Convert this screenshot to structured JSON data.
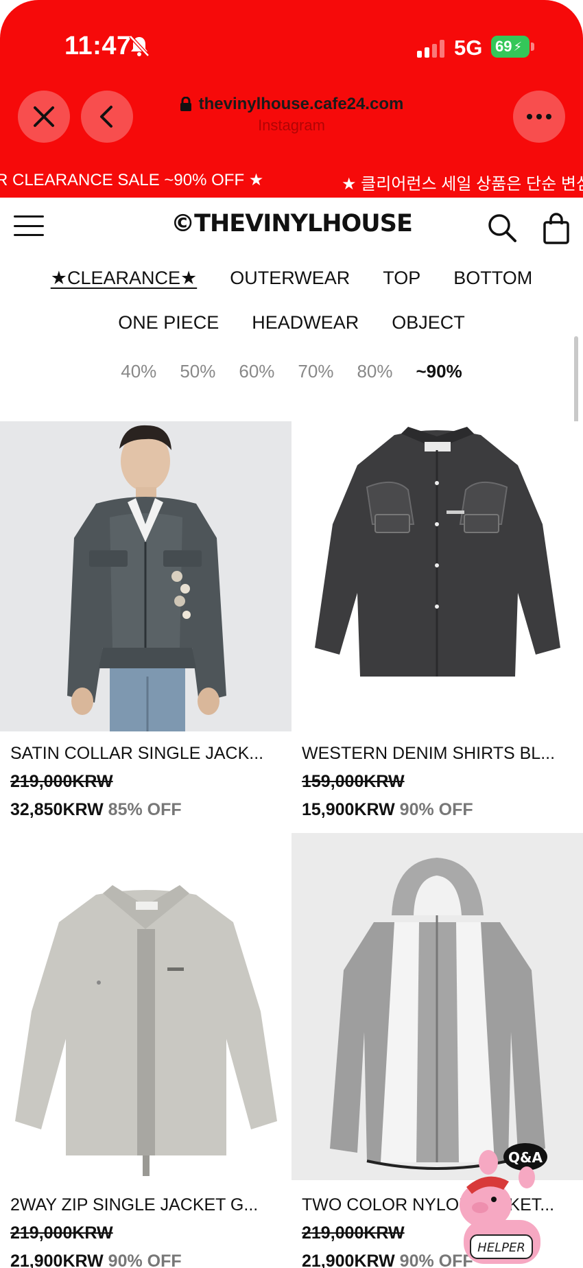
{
  "status_bar": {
    "time": "11:47",
    "network": "5G",
    "battery": "69"
  },
  "browser": {
    "url": "thevinylhouse.cafe24.com",
    "source": "Instagram"
  },
  "marquee": {
    "text_left": "R CLEARANCE SALE ~90% OFF ★",
    "text_right": "★ 클리어런스 세일 상품은 단순 변심"
  },
  "header": {
    "logo": "©THEVINYLHOUSE"
  },
  "categories": {
    "row1": [
      "★CLEARANCE★",
      "OUTERWEAR",
      "TOP",
      "BOTTOM"
    ],
    "row2": [
      "ONE PIECE",
      "HEADWEAR",
      "OBJECT"
    ]
  },
  "discounts": [
    "40%",
    "50%",
    "60%",
    "70%",
    "80%",
    "~90%"
  ],
  "products": [
    {
      "name": "SATIN COLLAR SINGLE JACK...",
      "original_price": "219,000KRW",
      "sale_price": "32,850KRW",
      "discount": "85% OFF"
    },
    {
      "name": "WESTERN DENIM SHIRTS BL...",
      "original_price": "159,000KRW",
      "sale_price": "15,900KRW",
      "discount": "90% OFF"
    },
    {
      "name": "2WAY ZIP SINGLE JACKET G...",
      "original_price": "219,000KRW",
      "sale_price": "21,900KRW",
      "discount": "90% OFF"
    },
    {
      "name": "TWO COLOR NYLON JACKET...",
      "original_price": "219,000KRW",
      "sale_price": "21,900KRW",
      "discount": "90% OFF"
    }
  ],
  "helper": {
    "bubble": "Q&A",
    "label": "HELPER"
  },
  "colors": {
    "chrome": "#f60a0a",
    "battery": "#34c759"
  }
}
